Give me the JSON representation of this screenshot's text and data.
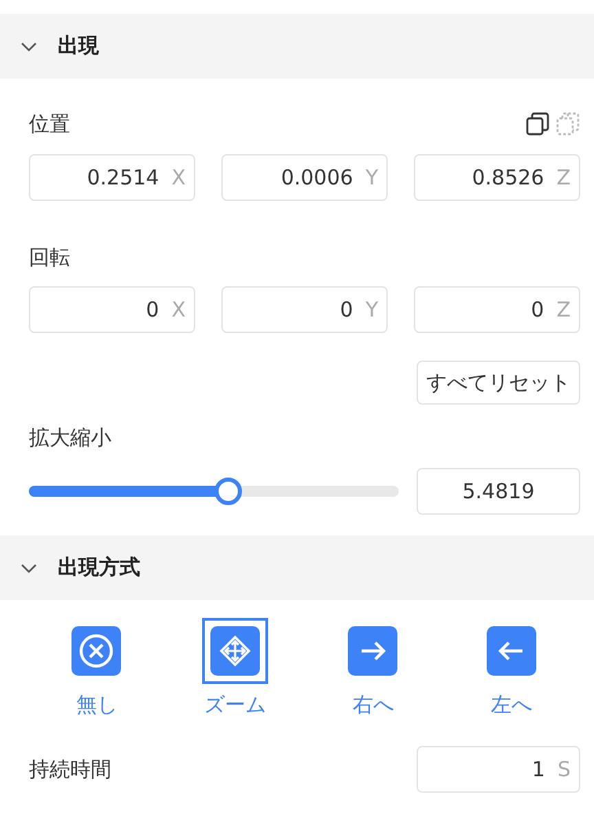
{
  "appearance": {
    "header": {
      "title": "出現",
      "expanded": true
    },
    "position": {
      "label": "位置",
      "icon_buttons": [
        {
          "kind": "copy",
          "disabled": false
        },
        {
          "kind": "paste",
          "disabled": true
        }
      ],
      "fields": [
        {
          "value": "0.2514",
          "axis": "X"
        },
        {
          "value": "0.0006",
          "axis": "Y"
        },
        {
          "value": "0.8526",
          "axis": "Z"
        }
      ]
    },
    "rotation": {
      "label": "回転",
      "fields": [
        {
          "value": "0",
          "axis": "X"
        },
        {
          "value": "0",
          "axis": "Y"
        },
        {
          "value": "0",
          "axis": "Z"
        }
      ]
    },
    "reset_button": "すべてリセット",
    "scale": {
      "label": "拡大縮小",
      "level": 0.54,
      "value": "5.4819"
    }
  },
  "appearance_mode": {
    "header": {
      "title": "出現方式",
      "expanded": true
    },
    "options": [
      {
        "kind": "none",
        "label": "無し",
        "selected": false
      },
      {
        "kind": "zoom",
        "label": "ズーム",
        "selected": true
      },
      {
        "kind": "right",
        "label": "右へ",
        "selected": false
      },
      {
        "kind": "left",
        "label": "左へ",
        "selected": false
      }
    ],
    "duration": {
      "label": "持続時間",
      "value": "1",
      "unit": "S"
    }
  }
}
